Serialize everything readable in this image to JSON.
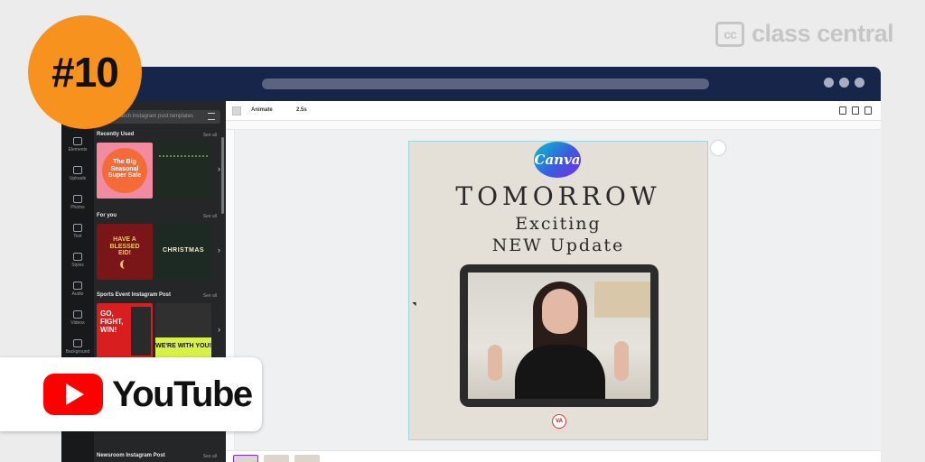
{
  "watermark": {
    "icon_text": "cc",
    "text": "class central"
  },
  "rank_badge": {
    "text": "#10"
  },
  "youtube": {
    "label": "YouTube"
  },
  "editor": {
    "rail": [
      {
        "label": "Elements",
        "icon": "shapes-icon"
      },
      {
        "label": "Uploads",
        "icon": "upload-icon"
      },
      {
        "label": "Photos",
        "icon": "photo-icon"
      },
      {
        "label": "Text",
        "icon": "text-icon"
      },
      {
        "label": "Styles",
        "icon": "palette-icon"
      },
      {
        "label": "Audio",
        "icon": "music-icon"
      },
      {
        "label": "Videos",
        "icon": "video-icon"
      },
      {
        "label": "Background",
        "icon": "background-icon"
      }
    ],
    "search_placeholder": "Search Instagram post templates",
    "sections": [
      {
        "title": "Recently Used",
        "see_all": "See all"
      },
      {
        "title": "For you",
        "see_all": "See all"
      },
      {
        "title": "Sports Event Instagram Post",
        "see_all": "See all"
      },
      {
        "title": "Newsroom Instagram Post",
        "see_all": "See all"
      }
    ],
    "thumb_texts": {
      "sale": "The Big Seasonal Super Sale",
      "blessed": "HAVE A BLESSED EID!",
      "christmas": "CHRISTMAS",
      "fight": "GO, FIGHT, WIN!",
      "withyou": "WE'RE WITH YOU!"
    },
    "toolbar": {
      "animate": "Animate",
      "duration": "2.5s"
    }
  },
  "design": {
    "brand": "Canva",
    "title": "TOMORROW",
    "line1": "Exciting",
    "line2": "NEW Update",
    "logo": "VA"
  },
  "colors": {
    "badge": "#f7921e",
    "titlebar": "#17254a",
    "youtube_red": "#ff0000",
    "panel": "#252627"
  }
}
